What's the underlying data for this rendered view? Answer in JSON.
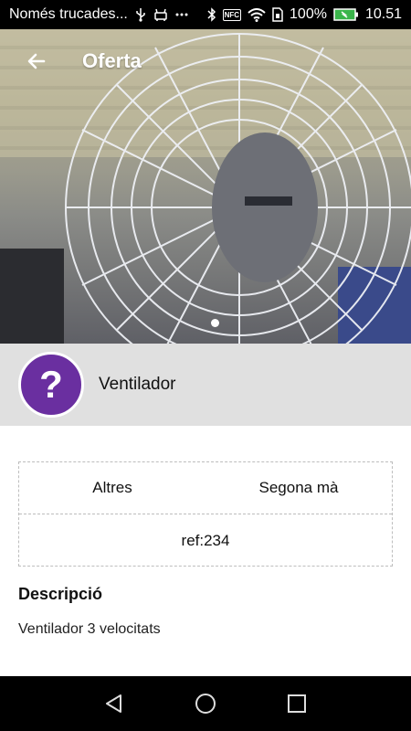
{
  "status_bar": {
    "carrier_text": "Només trucades...",
    "battery_percent": "100%",
    "time": "10.51",
    "nfc_label": "NFC",
    "icons": [
      "usb-icon",
      "android-debug-icon",
      "more-icon",
      "bluetooth-icon",
      "nfc-icon",
      "wifi-icon",
      "sim-icon",
      "battery-icon"
    ]
  },
  "app_bar": {
    "title": "Oferta",
    "back_icon": "arrow-back-icon"
  },
  "gallery": {
    "current_page": 1,
    "page_count": 1
  },
  "product": {
    "avatar_symbol": "?",
    "avatar_color": "#6a2fa0",
    "name": "Ventilador"
  },
  "details": {
    "category": "Altres",
    "condition": "Segona mà",
    "reference": "ref:234"
  },
  "description": {
    "title": "Descripció",
    "text": "Ventilador 3 velocitats"
  },
  "nav_bar": {
    "icons": [
      "nav-back-icon",
      "nav-home-icon",
      "nav-recents-icon"
    ]
  }
}
